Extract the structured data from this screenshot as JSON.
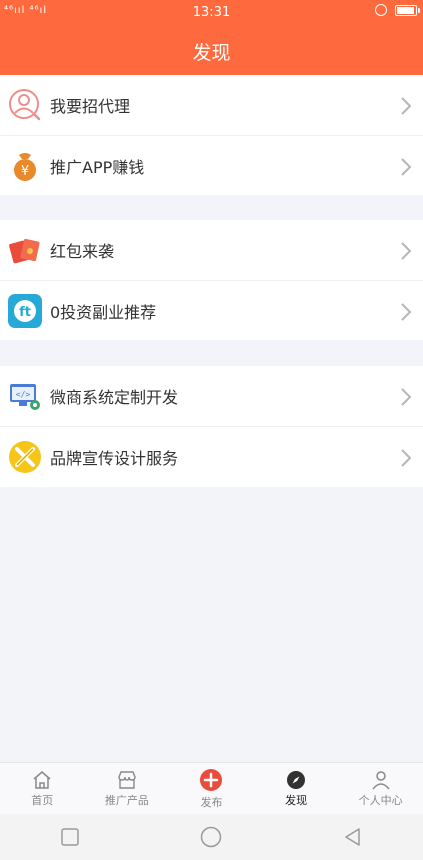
{
  "status": {
    "time": "13:31",
    "left": "⁴⁶ııl ⁴⁶ıl"
  },
  "header": {
    "title": "发现"
  },
  "groups": [
    [
      {
        "label": "我要招代理",
        "icon": "agent-icon"
      },
      {
        "label": "推广APP赚钱",
        "icon": "money-bag-icon"
      }
    ],
    [
      {
        "label": "红包来袭",
        "icon": "red-envelope-icon"
      },
      {
        "label": "0投资副业推荐",
        "icon": "sidejob-icon"
      }
    ],
    [
      {
        "label": "微商系统定制开发",
        "icon": "code-monitor-icon"
      },
      {
        "label": "品牌宣传设计服务",
        "icon": "design-icon"
      }
    ]
  ],
  "tabbar": [
    {
      "label": "首页",
      "icon": "home-icon"
    },
    {
      "label": "推广产品",
      "icon": "store-icon"
    },
    {
      "label": "发布",
      "icon": "plus-circle-icon"
    },
    {
      "label": "发现",
      "icon": "compass-icon",
      "active": true
    },
    {
      "label": "个人中心",
      "icon": "user-icon"
    }
  ],
  "colors": {
    "brand": "#fe6a3d",
    "background": "#f3f4f9"
  }
}
